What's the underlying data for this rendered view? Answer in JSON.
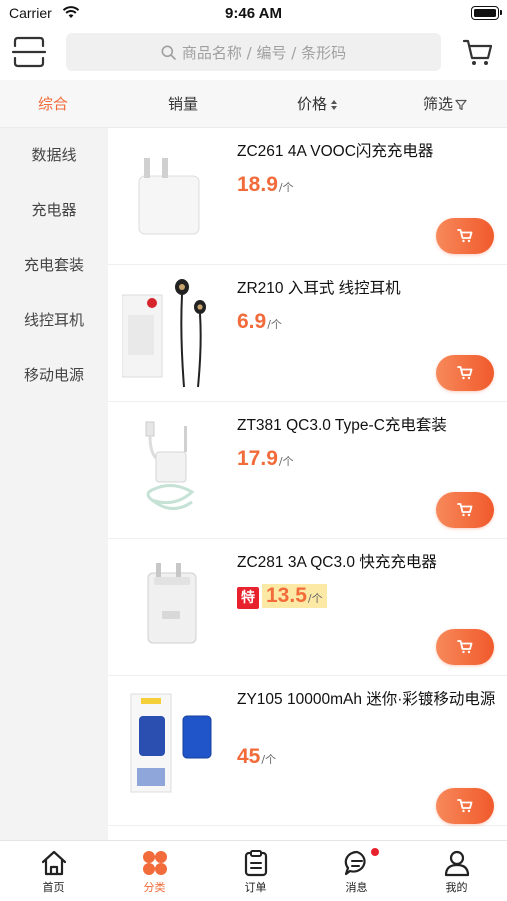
{
  "status_bar": {
    "carrier": "Carrier",
    "time": "9:46 AM"
  },
  "search": {
    "placeholder": "商品名称 / 编号 / 条形码"
  },
  "filters": [
    {
      "label": "综合",
      "active": true
    },
    {
      "label": "销量"
    },
    {
      "label": "价格",
      "icon": "sort-arrows-icon"
    },
    {
      "label": "筛选",
      "icon": "filter-funnel-icon"
    }
  ],
  "categories": [
    "数据线",
    "充电器",
    "充电套装",
    "线控耳机",
    "移动电源"
  ],
  "products": [
    {
      "name": "ZC261 4A VOOC闪充充电器",
      "price": "18.9",
      "unit": "/个"
    },
    {
      "name": "ZR210 入耳式 线控耳机",
      "price": "6.9",
      "unit": "/个"
    },
    {
      "name": "ZT381 QC3.0 Type-C充电套装",
      "price": "17.9",
      "unit": "/个"
    },
    {
      "name": "ZC281 3A QC3.0 快充充电器",
      "price": "13.5",
      "unit": "/个",
      "special_tag": "特"
    },
    {
      "name": "ZY105 10000mAh 迷你·彩镀移动电源",
      "price": "45",
      "unit": "/个"
    }
  ],
  "tabbar": [
    {
      "label": "首页",
      "icon": "home-icon"
    },
    {
      "label": "分类",
      "icon": "category-icon",
      "active": true
    },
    {
      "label": "订单",
      "icon": "order-icon"
    },
    {
      "label": "消息",
      "icon": "message-icon",
      "badge": true
    },
    {
      "label": "我的",
      "icon": "profile-icon"
    }
  ],
  "colors": {
    "accent": "#f26b3a",
    "special_tag": "#e8222c",
    "special_bg": "#fde9a6"
  }
}
